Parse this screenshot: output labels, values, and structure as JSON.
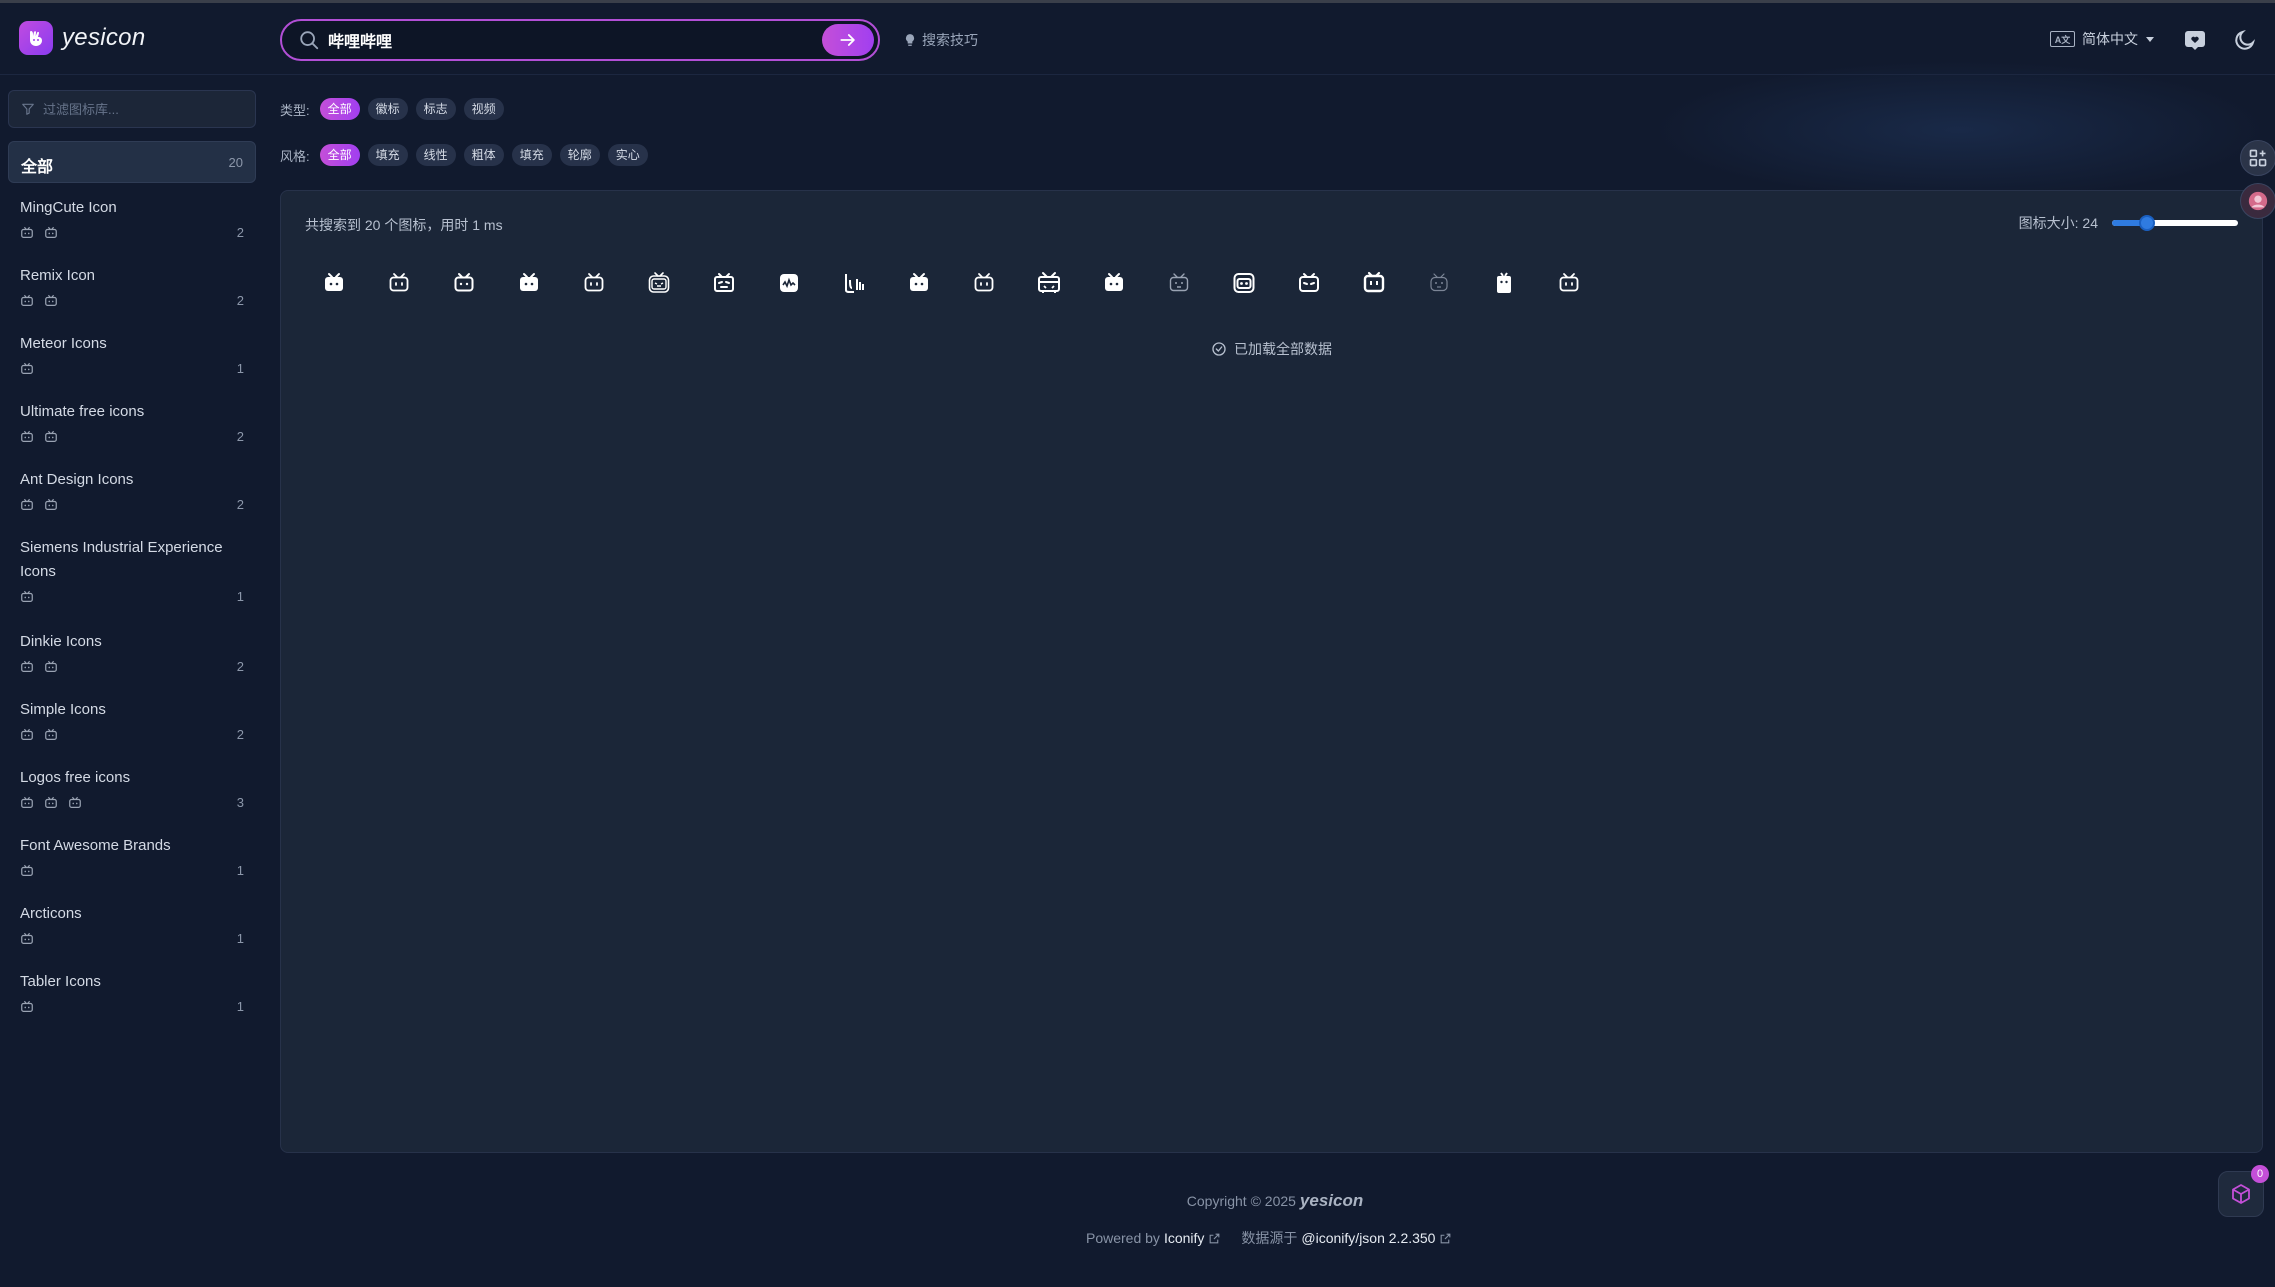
{
  "app": {
    "name": "yesicon"
  },
  "search": {
    "value": "哔哩哔哩",
    "tips_label": "搜索技巧"
  },
  "header": {
    "language": "简体中文",
    "lang_badge": "A文"
  },
  "sidebar": {
    "filter_placeholder": "过滤图标库...",
    "all": {
      "label": "全部",
      "count": "20"
    },
    "collections": [
      {
        "name": "MingCute Icon",
        "count": "2",
        "icons": 2
      },
      {
        "name": "Remix Icon",
        "count": "2",
        "icons": 2
      },
      {
        "name": "Meteor Icons",
        "count": "1",
        "icons": 1
      },
      {
        "name": "Ultimate free icons",
        "count": "2",
        "icons": 2
      },
      {
        "name": "Ant Design Icons",
        "count": "2",
        "icons": 2
      },
      {
        "name": "Siemens Industrial Experience Icons",
        "count": "1",
        "icons": 1
      },
      {
        "name": "Dinkie Icons",
        "count": "2",
        "icons": 2
      },
      {
        "name": "Simple Icons",
        "count": "2",
        "icons": 2
      },
      {
        "name": "Logos free icons",
        "count": "3",
        "icons": 3
      },
      {
        "name": "Font Awesome Brands",
        "count": "1",
        "icons": 1
      },
      {
        "name": "Arcticons",
        "count": "1",
        "icons": 1
      },
      {
        "name": "Tabler Icons",
        "count": "1",
        "icons": 1
      }
    ]
  },
  "filters": {
    "type_label": "类型:",
    "types": [
      "全部",
      "徽标",
      "标志",
      "视频"
    ],
    "style_label": "风格:",
    "styles": [
      "全部",
      "填充",
      "线性",
      "粗体",
      "填充",
      "轮廓",
      "实心"
    ]
  },
  "results": {
    "summary": "共搜索到 20 个图标，用时 1 ms",
    "size_label": "图标大小: 24",
    "size_level_percent": 28,
    "loaded_text": "已加载全部数据",
    "icon_names": [
      "bilibili-fill",
      "bilibili-line",
      "bilibili-icon",
      "bilibili-tv",
      "bilibili-outline",
      "bilibili-bold",
      "bilibili-smile",
      "bilibili-wave",
      "bilibili-chart",
      "bilibili-solid",
      "bilibili-antenna",
      "bilibili-tv-fill",
      "bilibili-square",
      "bilibili-face",
      "bilibili-box",
      "bilibili-round",
      "bilibili-classic",
      "bilibili-faint",
      "bilibili-logo",
      "bilibili-mini"
    ]
  },
  "footer": {
    "copyright": "Copyright © 2025",
    "brand": "yesicon",
    "powered_by": "Powered by",
    "iconify": "Iconify",
    "data_source": "数据源于",
    "package": "@iconify/json 2.2.350"
  },
  "cart": {
    "count": "0"
  },
  "colors": {
    "accent": "#c44fd8",
    "accent2": "#a13ff0",
    "bg": "#111a2e",
    "panel": "#1b2638",
    "slider": "#2f7be0"
  }
}
